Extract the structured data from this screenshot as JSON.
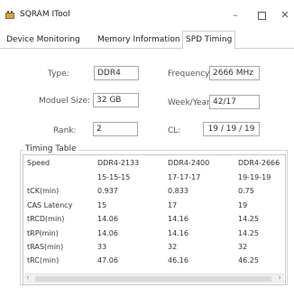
{
  "window": {
    "title": "SQRAM ITool",
    "minimize_glyph": "–",
    "close_glyph": "✕"
  },
  "tabs": [
    {
      "label": "Device Monitoring"
    },
    {
      "label": "Memory Information"
    },
    {
      "label": "SPD Timing",
      "active": true
    }
  ],
  "spd": {
    "type_label": "Type:",
    "type_value": "DDR4",
    "frequency_label": "Frequency:",
    "frequency_value": "2666 MHz",
    "module_size_label": "Moduel Size:",
    "module_size_value": "32 GB",
    "week_year_label": "Week/Year:",
    "week_year_value": "42/17",
    "rank_label": "Rank:",
    "rank_value": "2",
    "cl_label": "CL:",
    "cl_value": "19 / 19 / 19"
  },
  "timing_table": {
    "title": "Timing Table",
    "header": [
      "Speed",
      "DDR4-2133",
      "DDR4-2400",
      "DDR4-2666"
    ],
    "rows": [
      [
        "",
        "15-15-15",
        "17-17-17",
        "19-19-19"
      ],
      [
        "tCK(min)",
        "0.937",
        "0.833",
        "0.75"
      ],
      [
        "CAS Latency",
        "15",
        "17",
        "19"
      ],
      [
        "tRCD(min)",
        "14.06",
        "14.16",
        "14.25"
      ],
      [
        "tRP(min)",
        "14.06",
        "14.16",
        "14.25"
      ],
      [
        "tRAS(min)",
        "33",
        "32",
        "32"
      ],
      [
        "tRC(min)",
        "47.06",
        "46.16",
        "46.25"
      ]
    ]
  },
  "scrollbar": {
    "left_arrow": "‹",
    "right_arrow": "›"
  }
}
